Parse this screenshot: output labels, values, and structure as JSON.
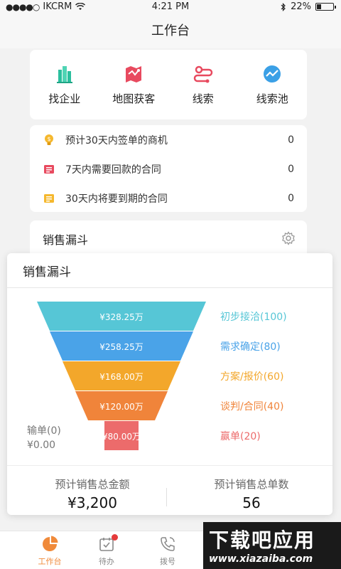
{
  "status_bar": {
    "signal": "●●●●○",
    "carrier": "IKCRM",
    "time": "4:21 PM",
    "battery": "22%"
  },
  "header": {
    "title": "工作台"
  },
  "quick_actions": [
    {
      "label": "找企业",
      "icon": "building-icon",
      "color": "#2bbf9e"
    },
    {
      "label": "地图获客",
      "icon": "map-icon",
      "color": "#e84a5f"
    },
    {
      "label": "线索",
      "icon": "lead-icon",
      "color": "#e84a5f"
    },
    {
      "label": "线索池",
      "icon": "trend-icon",
      "color": "#3ba0e6"
    }
  ],
  "stats": [
    {
      "label": "预计30天内签单的商机",
      "value": "0",
      "icon": "bulb-icon"
    },
    {
      "label": "7天内需要回款的合同",
      "value": "0",
      "icon": "contract-red-icon"
    },
    {
      "label": "30天内将要到期的合同",
      "value": "0",
      "icon": "contract-yellow-icon"
    }
  ],
  "funnel_section": {
    "title": "销售漏斗"
  },
  "popup": {
    "title": "销售漏斗",
    "lost_label": "输单(0)",
    "lost_amount": "¥0.00",
    "total_amount_label": "预计销售总金额",
    "total_amount": "¥3,200",
    "total_count_label": "预计销售总单数",
    "total_count": "56"
  },
  "chart_data": {
    "type": "funnel",
    "stages": [
      {
        "amount": "¥328.25万",
        "label": "初步接洽(100)",
        "color": "#56c6d6"
      },
      {
        "amount": "¥258.25万",
        "label": "需求确定(80)",
        "color": "#4aa3e8"
      },
      {
        "amount": "¥168.00万",
        "label": "方案/报价(60)",
        "color": "#f3a72b"
      },
      {
        "amount": "¥120.00万",
        "label": "谈判/合同(40)",
        "color": "#f0843a"
      },
      {
        "amount": "¥80.00万",
        "label": "赢单(20)",
        "color": "#ec6b6b"
      }
    ]
  },
  "tabs": [
    {
      "label": "工作台",
      "icon": "pie-chart-icon",
      "active": true
    },
    {
      "label": "待办",
      "icon": "calendar-check-icon",
      "badge": true
    },
    {
      "label": "拨号",
      "icon": "phone-icon"
    }
  ],
  "watermark": {
    "big": "下载吧应用",
    "small": "www.xiazaiba.com"
  }
}
